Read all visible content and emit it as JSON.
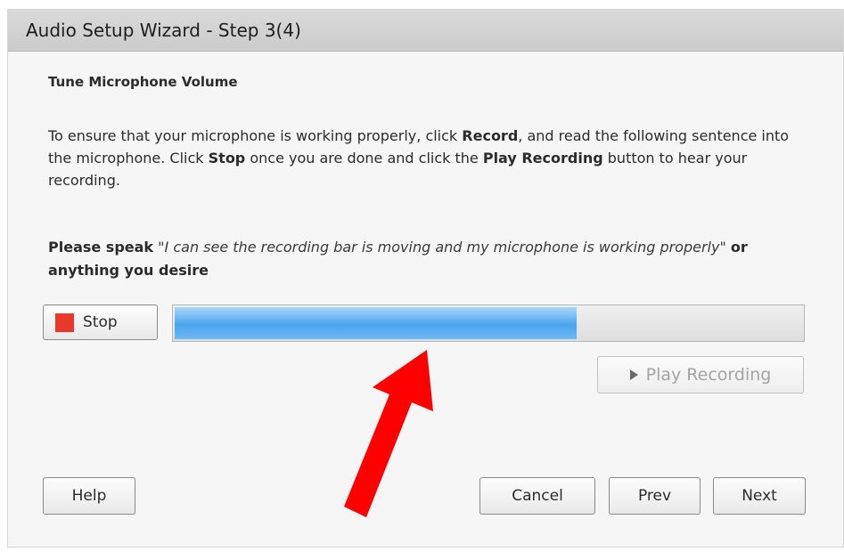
{
  "window": {
    "title": "Audio Setup Wizard - Step 3(4)"
  },
  "content": {
    "heading": "Tune Microphone Volume",
    "instructions": {
      "part1": "To ensure that your microphone is working properly, click ",
      "record_word": "Record",
      "part2": ", and read the following sentence into the microphone. Click ",
      "stop_word": "Stop",
      "part3": " once you are done and click the ",
      "play_word": "Play Recording",
      "part4": " button to hear your recording."
    },
    "speak": {
      "prefix": "Please speak",
      "quote": "\"I can see the recording bar is moving and my microphone is working properly\"",
      "suffix": "or anything you desire"
    }
  },
  "recording": {
    "stop_label": "Stop",
    "level_percent": 64,
    "play_label": "Play Recording",
    "play_enabled": false
  },
  "footer": {
    "help_label": "Help",
    "cancel_label": "Cancel",
    "prev_label": "Prev",
    "next_label": "Next"
  },
  "annotation": {
    "arrow_color": "#ff0000"
  },
  "colors": {
    "stop_icon": "#e8392b",
    "level_fill": "#4aa5ef"
  },
  "icons": {
    "stop": "stop-square-icon",
    "play": "play-triangle-icon"
  }
}
